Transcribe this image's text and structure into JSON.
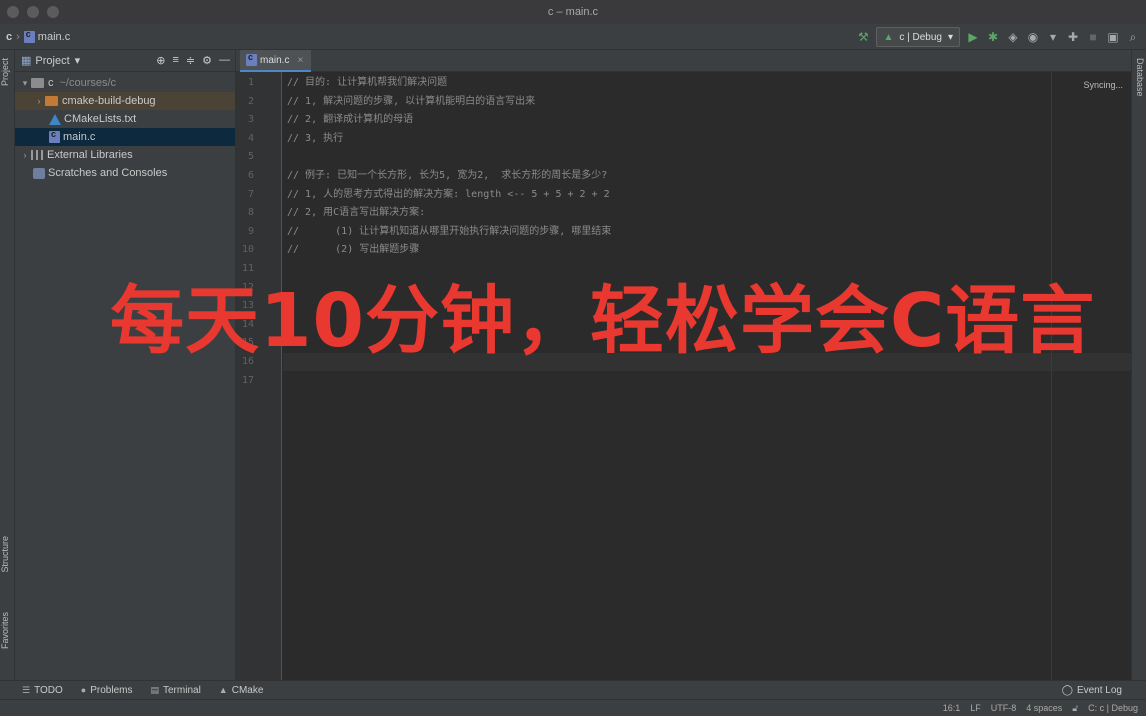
{
  "window": {
    "title": "c – main.c"
  },
  "nav": {
    "project": "c",
    "file": "main.c",
    "config": "c | Debug"
  },
  "left_strip": {
    "project_tab": "Project",
    "structure_tab": "Structure",
    "favorites_tab": "Favorites"
  },
  "right_strip": {
    "database_tab": "Database"
  },
  "project_panel": {
    "header": "Project",
    "root": {
      "name": "c",
      "path": "~/courses/c"
    },
    "items": [
      {
        "name": "cmake-build-debug"
      },
      {
        "name": "CMakeLists.txt"
      },
      {
        "name": "main.c"
      },
      {
        "name": "External Libraries"
      },
      {
        "name": "Scratches and Consoles"
      }
    ]
  },
  "editor": {
    "tab": "main.c",
    "status": "Syncing...",
    "line_numbers": [
      "1",
      "2",
      "3",
      "4",
      "5",
      "6",
      "7",
      "8",
      "9",
      "10",
      "11",
      "12",
      "13",
      "14",
      "15",
      "16",
      "17"
    ],
    "lines": [
      "// 目的: 让计算机帮我们解决问题",
      "// 1, 解决问题的步骤, 以计算机能明白的语言写出来",
      "// 2, 翻译成计算机的母语",
      "// 3, 执行",
      "",
      "// 例子: 已知一个长方形, 长为5, 宽为2,  求长方形的周长是多少?",
      "// 1, 人的思考方式得出的解决方案: length <-- 5 + 5 + 2 + 2",
      "// 2, 用C语言写出解决方案:",
      "//      (1) 让计算机知道从哪里开始执行解决问题的步骤, 哪里结束",
      "//      (2) 写出解题步骤",
      "",
      "",
      "",
      "",
      "",
      "",
      ""
    ]
  },
  "overlay": {
    "caption": "每天10分钟，轻松学会C语言"
  },
  "bottom_tabs": {
    "todo": "TODO",
    "problems": "Problems",
    "terminal": "Terminal",
    "cmake": "CMake",
    "event_log": "Event Log"
  },
  "status": {
    "position": "16:1",
    "line_sep": "LF",
    "encoding": "UTF-8",
    "indent": "4 spaces",
    "context": "C: c | Debug"
  }
}
